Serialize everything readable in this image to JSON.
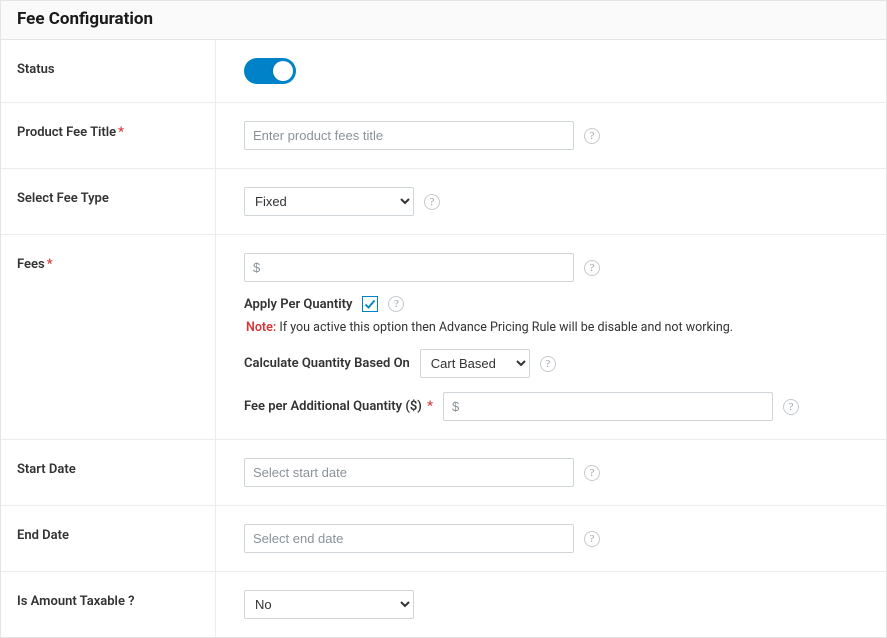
{
  "header": {
    "title": "Fee Configuration"
  },
  "rows": {
    "status": {
      "label": "Status",
      "value": true
    },
    "product_fee_title": {
      "label": "Product Fee Title",
      "required": "*",
      "placeholder": "Enter product fees title",
      "value": ""
    },
    "select_fee_type": {
      "label": "Select Fee Type",
      "selected": "Fixed",
      "options": [
        "Fixed"
      ]
    },
    "fees": {
      "label": "Fees",
      "required": "*",
      "placeholder": "$",
      "value": "",
      "apply_per_qty_label": "Apply Per Quantity",
      "apply_per_qty_checked": true,
      "note_prefix": "Note:",
      "note_text": " If you active this option then Advance Pricing Rule will be disable and not working.",
      "calc_label": "Calculate Quantity Based On",
      "calc_selected": "Cart Based",
      "calc_options": [
        "Cart Based"
      ],
      "fee_per_add_label": "Fee per Additional Quantity ($)",
      "fee_per_add_required": "*",
      "fee_per_add_placeholder": "$",
      "fee_per_add_value": ""
    },
    "start_date": {
      "label": "Start Date",
      "placeholder": "Select start date",
      "value": ""
    },
    "end_date": {
      "label": "End Date",
      "placeholder": "Select end date",
      "value": ""
    },
    "taxable": {
      "label": "Is Amount Taxable ?",
      "selected": "No",
      "options": [
        "No"
      ]
    }
  },
  "glyphs": {
    "help": "?"
  }
}
